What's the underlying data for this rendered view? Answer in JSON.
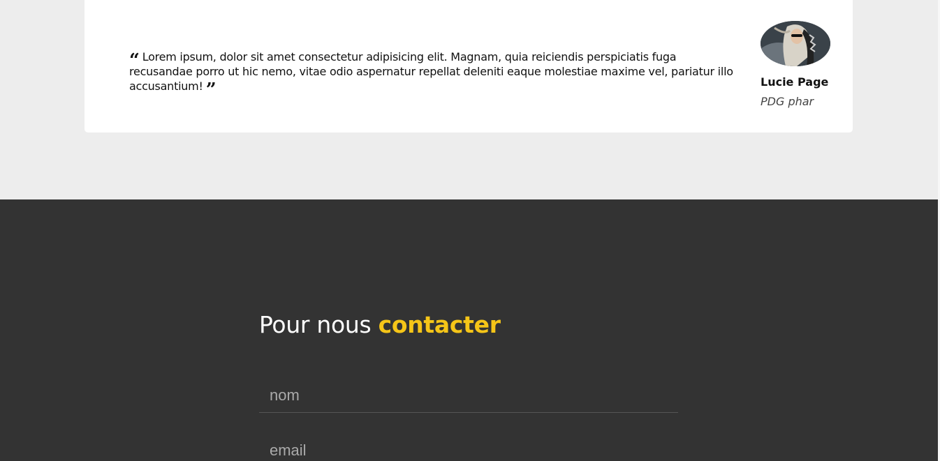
{
  "testimonial": {
    "quote": "Lorem ipsum, dolor sit amet consectetur adipisicing elit. Magnam, quia reiciendis perspiciatis fuga recusandae porro ut hic nemo, vitae odio aspernatur repellat deleniti eaque molestiae maxime vel, pariatur illo accusantium!",
    "open_quote_icon": "quote-left-icon",
    "close_quote_icon": "quote-right-icon",
    "author_name": "Lucie Page",
    "author_role": "PDG phar"
  },
  "contact": {
    "title_prefix": "Pour nous",
    "title_accent": "contacter",
    "name_placeholder": "nom",
    "email_placeholder": "email"
  },
  "colors": {
    "accent": "#f5c518",
    "top_background": "#ededed",
    "contact_background": "#333333",
    "card_background": "#ffffff"
  }
}
